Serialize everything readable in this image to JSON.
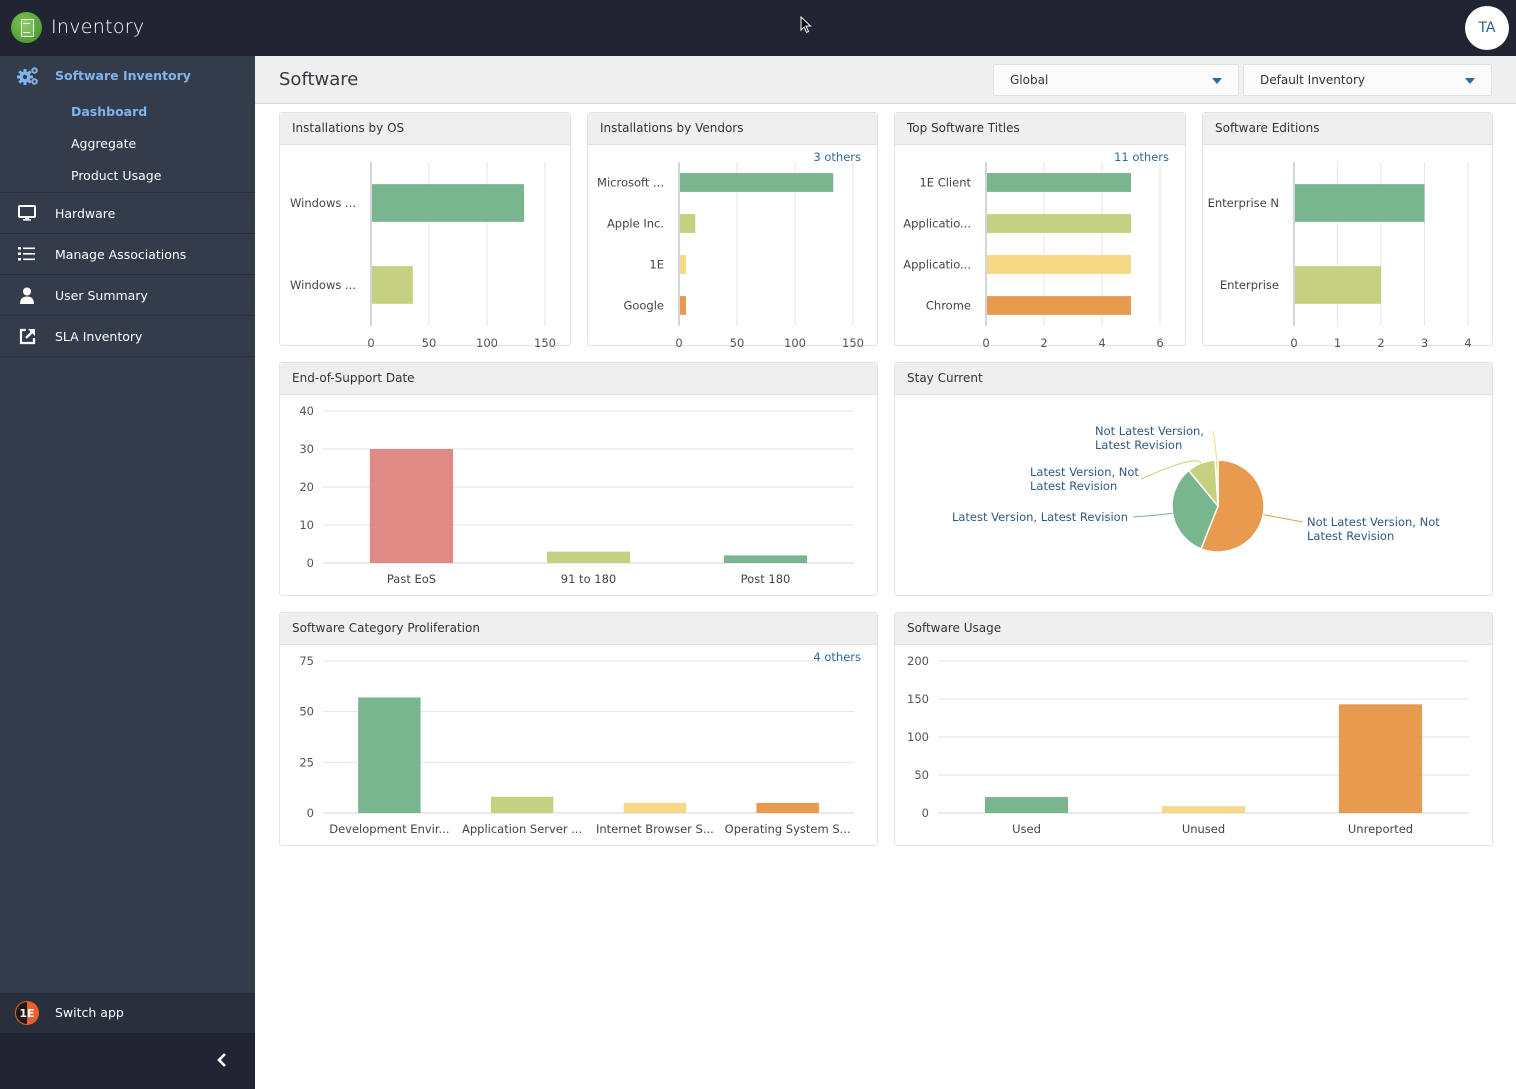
{
  "app": {
    "title": "Inventory",
    "avatar_initials": "TA"
  },
  "sidebar": {
    "group": {
      "label": "Software Inventory",
      "icon": "cogs-icon",
      "items": [
        {
          "label": "Dashboard",
          "active": true
        },
        {
          "label": "Aggregate",
          "active": false
        },
        {
          "label": "Product Usage",
          "active": false
        }
      ]
    },
    "items": [
      {
        "label": "Hardware",
        "icon": "monitor-icon"
      },
      {
        "label": "Manage Associations",
        "icon": "ordered-list-icon"
      },
      {
        "label": "User Summary",
        "icon": "user-icon"
      },
      {
        "label": "SLA Inventory",
        "icon": "external-link-icon"
      }
    ],
    "switch_app": {
      "label": "Switch app",
      "badge": "1E"
    },
    "collapse_icon": "chevron-left-icon"
  },
  "page": {
    "title": "Software",
    "scope_select": {
      "value": "Global"
    },
    "inventory_select": {
      "value": "Default Inventory"
    }
  },
  "colors": {
    "green": "#79b58f",
    "lightgreen": "#c5d180",
    "yellow": "#f5d985",
    "orange": "#e89a4f",
    "red": "#e08a86",
    "link": "#2e6aa1"
  },
  "chart_data": [
    {
      "id": "os",
      "type": "bar",
      "orientation": "horizontal",
      "title": "Installations by OS",
      "categories": [
        "Windows ...",
        "Windows ..."
      ],
      "values": [
        132,
        36
      ],
      "colors": [
        "#79b58f",
        "#c5d180"
      ],
      "xlim": [
        0,
        150
      ],
      "ticks": [
        0,
        50,
        100,
        150
      ],
      "others": null
    },
    {
      "id": "vendors",
      "type": "bar",
      "orientation": "horizontal",
      "title": "Installations by Vendors",
      "categories": [
        "Microsoft ...",
        "Apple Inc.",
        "1E",
        "Google"
      ],
      "values": [
        133,
        14,
        6,
        6
      ],
      "colors": [
        "#79b58f",
        "#c5d180",
        "#f5d985",
        "#e89a4f"
      ],
      "xlim": [
        0,
        150
      ],
      "ticks": [
        0,
        50,
        100,
        150
      ],
      "others": "3 others"
    },
    {
      "id": "titles",
      "type": "bar",
      "orientation": "horizontal",
      "title": "Top Software Titles",
      "categories": [
        "1E Client",
        "Applicatio...",
        "Applicatio...",
        "Chrome"
      ],
      "values": [
        5,
        5,
        5,
        5
      ],
      "colors": [
        "#79b58f",
        "#c5d180",
        "#f5d985",
        "#e89a4f"
      ],
      "xlim": [
        0,
        6
      ],
      "ticks": [
        0,
        2,
        4,
        6
      ],
      "others": "11 others"
    },
    {
      "id": "editions",
      "type": "bar",
      "orientation": "horizontal",
      "title": "Software Editions",
      "categories": [
        "Enterprise N",
        "Enterprise"
      ],
      "values": [
        3,
        2
      ],
      "colors": [
        "#79b58f",
        "#c5d180"
      ],
      "xlim": [
        0,
        4
      ],
      "ticks": [
        0,
        1,
        2,
        3,
        4
      ],
      "others": null
    },
    {
      "id": "eos",
      "type": "bar",
      "orientation": "vertical",
      "title": "End-of-Support Date",
      "categories": [
        "Past EoS",
        "91 to 180",
        "Post 180"
      ],
      "values": [
        30,
        3,
        2
      ],
      "colors": [
        "#e08a86",
        "#c5d180",
        "#79b58f"
      ],
      "ylim": [
        0,
        40
      ],
      "ticks": [
        0,
        10,
        20,
        30,
        40
      ],
      "others": null
    },
    {
      "id": "staycurrent",
      "type": "pie",
      "title": "Stay Current",
      "slices": [
        {
          "label": "Not Latest Version, Not Latest Revision",
          "lines": [
            "Not Latest Version, Not",
            "Latest Revision"
          ],
          "value": 56,
          "color": "#e89a4f"
        },
        {
          "label": "Latest Version, Latest Revision",
          "lines": [
            "Latest Version, Latest Revision"
          ],
          "value": 33,
          "color": "#79b58f"
        },
        {
          "label": "Latest Version, Not Latest Revision",
          "lines": [
            "Latest Version, Not",
            "Latest Revision"
          ],
          "value": 10,
          "color": "#c5d180"
        },
        {
          "label": "Not Latest Version, Latest Revision",
          "lines": [
            "Not Latest Version,",
            "Latest Revision"
          ],
          "value": 1,
          "color": "#f5d985"
        }
      ]
    },
    {
      "id": "category",
      "type": "bar",
      "orientation": "vertical",
      "title": "Software Category Proliferation",
      "categories": [
        "Development Envir...",
        "Application Server ...",
        "Internet Browser S...",
        "Operating System S..."
      ],
      "values": [
        57,
        8,
        5,
        5
      ],
      "colors": [
        "#79b58f",
        "#c5d180",
        "#f5d985",
        "#e89a4f"
      ],
      "ylim": [
        0,
        75
      ],
      "ticks": [
        0,
        25,
        50,
        75
      ],
      "others": "4 others"
    },
    {
      "id": "usage",
      "type": "bar",
      "orientation": "vertical",
      "title": "Software Usage",
      "categories": [
        "Used",
        "Unused",
        "Unreported"
      ],
      "values": [
        21,
        9,
        143
      ],
      "colors": [
        "#79b58f",
        "#f5d985",
        "#e89a4f"
      ],
      "ylim": [
        0,
        200
      ],
      "ticks": [
        0,
        50,
        100,
        150,
        200
      ],
      "others": null
    }
  ]
}
